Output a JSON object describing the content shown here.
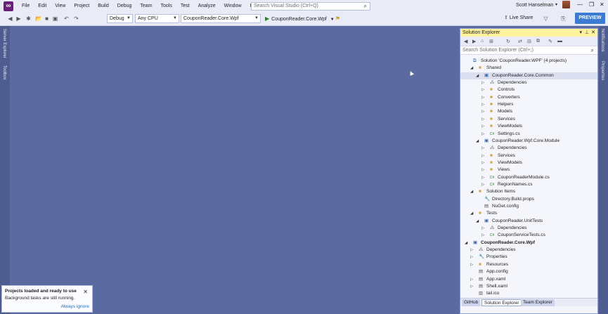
{
  "menubar": {
    "items": [
      "File",
      "Edit",
      "View",
      "Project",
      "Build",
      "Debug",
      "Team",
      "Tools",
      "Test",
      "Analyze",
      "Window",
      "Help"
    ],
    "search_placeholder": "Search Visual Studio (Ctrl+Q)",
    "user_name": "Scott Hanselman",
    "logo_icon": "visual-studio-logo-icon"
  },
  "toolbar": {
    "config": "Debug",
    "platform": "Any CPU",
    "startup_project": "CouponReader.Core.Wpf",
    "run_target": "CouponReader.Core.Wpf",
    "live_share": "Live Share",
    "preview": "PREVIEW",
    "accent": "#3b7bd1"
  },
  "side_tabs": {
    "left": [
      "Server Explorer",
      "Toolbox"
    ],
    "right": [
      "Notifications",
      "Properties"
    ]
  },
  "solution_explorer": {
    "title": "Solution Explorer",
    "search_placeholder": "Search Solution Explorer (Ctrl+;)",
    "tree": [
      {
        "label": "Solution 'CouponReader.WPF' (4 projects)",
        "icon": "solution-icon",
        "level": 0,
        "expander": ""
      },
      {
        "label": "Shared",
        "icon": "folder-icon",
        "level": 1,
        "expander": "◢"
      },
      {
        "label": "CouponReader.Core.Common",
        "icon": "project-icon",
        "level": 2,
        "expander": "◢",
        "selected": true
      },
      {
        "label": "Dependencies",
        "icon": "dependencies-icon",
        "level": 3,
        "expander": "▷"
      },
      {
        "label": "Controls",
        "icon": "folder-icon",
        "level": 3,
        "expander": "▷"
      },
      {
        "label": "Converters",
        "icon": "folder-icon",
        "level": 3,
        "expander": "▷"
      },
      {
        "label": "Helpers",
        "icon": "folder-icon",
        "level": 3,
        "expander": "▷"
      },
      {
        "label": "Models",
        "icon": "folder-icon",
        "level": 3,
        "expander": "▷"
      },
      {
        "label": "Services",
        "icon": "folder-icon",
        "level": 3,
        "expander": "▷"
      },
      {
        "label": "ViewModels",
        "icon": "folder-icon",
        "level": 3,
        "expander": "▷"
      },
      {
        "label": "Settings.cs",
        "icon": "csharp-file-icon",
        "level": 3,
        "expander": "▷"
      },
      {
        "label": "CouponReader.Wpf.Core.Module",
        "icon": "project-icon",
        "level": 2,
        "expander": "◢"
      },
      {
        "label": "Dependencies",
        "icon": "dependencies-icon",
        "level": 3,
        "expander": "▷"
      },
      {
        "label": "Services",
        "icon": "folder-icon",
        "level": 3,
        "expander": "▷"
      },
      {
        "label": "ViewModels",
        "icon": "folder-icon",
        "level": 3,
        "expander": "▷"
      },
      {
        "label": "Views",
        "icon": "folder-icon",
        "level": 3,
        "expander": "▷"
      },
      {
        "label": "CouponReaderModule.cs",
        "icon": "csharp-file-icon",
        "level": 3,
        "expander": "▷"
      },
      {
        "label": "RegionNames.cs",
        "icon": "csharp-file-icon",
        "level": 3,
        "expander": "▷"
      },
      {
        "label": "Solution Items",
        "icon": "folder-icon",
        "level": 1,
        "expander": "◢"
      },
      {
        "label": "Directory.Build.props",
        "icon": "wrench-icon",
        "level": 2,
        "expander": ""
      },
      {
        "label": "NuGet.config",
        "icon": "config-file-icon",
        "level": 2,
        "expander": ""
      },
      {
        "label": "Tests",
        "icon": "folder-icon",
        "level": 1,
        "expander": "◢"
      },
      {
        "label": "CouponReader.UnitTests",
        "icon": "test-project-icon",
        "level": 2,
        "expander": "◢"
      },
      {
        "label": "Dependencies",
        "icon": "dependencies-icon",
        "level": 3,
        "expander": "▷"
      },
      {
        "label": "CouponServiceTests.cs",
        "icon": "csharp-file-icon",
        "level": 3,
        "expander": "▷"
      },
      {
        "label": "CouponReader.Core.Wpf",
        "icon": "project-icon",
        "level": 0,
        "expander": "◢",
        "bold": true
      },
      {
        "label": "Dependencies",
        "icon": "dependencies-icon",
        "level": 1,
        "expander": "▷"
      },
      {
        "label": "Properties",
        "icon": "wrench-icon",
        "level": 1,
        "expander": "▷"
      },
      {
        "label": "Resources",
        "icon": "folder-icon",
        "level": 1,
        "expander": "▷"
      },
      {
        "label": "App.config",
        "icon": "config-file-icon",
        "level": 1,
        "expander": ""
      },
      {
        "label": "App.xaml",
        "icon": "xaml-file-icon",
        "level": 1,
        "expander": "▷"
      },
      {
        "label": "Shell.xaml",
        "icon": "xaml-file-icon",
        "level": 1,
        "expander": "▷"
      },
      {
        "label": "tail.ico",
        "icon": "image-file-icon",
        "level": 1,
        "expander": ""
      }
    ],
    "tabs": [
      "GitHub",
      "Solution Explorer",
      "Team Explorer"
    ],
    "active_tab": "Solution Explorer"
  },
  "notification": {
    "title": "Projects loaded and ready to use",
    "subtitle": "Background tasks are still running.",
    "link": "Always ignore"
  }
}
